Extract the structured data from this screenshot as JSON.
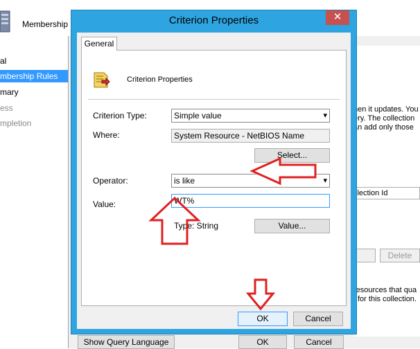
{
  "background": {
    "title": "Membership",
    "nav": [
      {
        "label": "al",
        "state": "normal"
      },
      {
        "label": "mbership Rules",
        "state": "selected"
      },
      {
        "label": "mary",
        "state": "normal"
      },
      {
        "label": "ess",
        "state": "dim"
      },
      {
        "label": "mpletion",
        "state": "dim"
      }
    ],
    "right_text": [
      "hen it updates. You",
      "ery. The collection",
      "an add only those"
    ],
    "column_header": "llection Id",
    "delete_label": "Delete",
    "bottom_text": [
      "resources that qua",
      "for this collection."
    ],
    "show_query_label": "Show Query Language",
    "ok_label": "OK",
    "cancel_label": "Cancel"
  },
  "dialog": {
    "title": "Criterion Properties",
    "close_glyph": "✕",
    "tab_label": "General",
    "heading": "Criterion Properties",
    "criterion_type": {
      "label": "Criterion Type:",
      "value": "Simple value"
    },
    "where": {
      "label": "Where:",
      "value": "System Resource - NetBIOS Name"
    },
    "select_label": "Select...",
    "operator": {
      "label": "Operator:",
      "value": "is like"
    },
    "value_field": {
      "label": "Value:",
      "value": "WT%"
    },
    "type_text": "Type:  String",
    "value_button_label": "Value...",
    "ok_label": "OK",
    "cancel_label": "Cancel"
  },
  "annotation_color": "#e02020"
}
